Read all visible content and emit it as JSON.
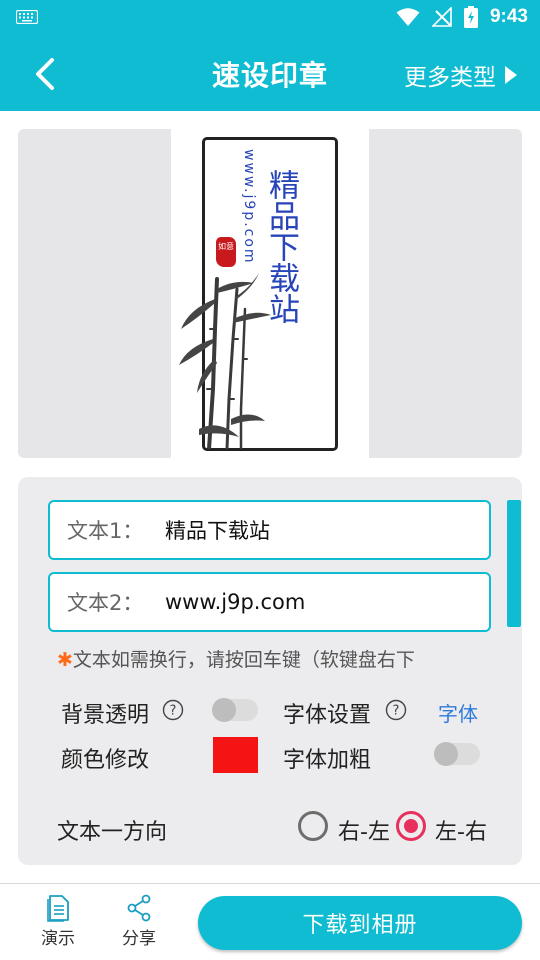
{
  "status_bar": {
    "time": "9:43",
    "icons": [
      "keyboard-icon",
      "wifi-icon",
      "no-signal-icon",
      "battery-charging-icon"
    ]
  },
  "header": {
    "title": "速设印章",
    "more_types": "更多类型",
    "back_icon": "chevron-left-icon",
    "more_icon": "triangle-right-icon"
  },
  "preview": {
    "stamp_text_1": "精品下载站",
    "stamp_text_2": "www.j9p.com",
    "seal_text": "如意",
    "colors": {
      "text": "#2745b9",
      "seal": "#c8191d",
      "frame": "#222222"
    }
  },
  "form": {
    "text1_label": "文本1：",
    "text1_value": "精品下载站",
    "text2_label": "文本2：",
    "text2_value": "www.j9p.com",
    "hint_star": "✱",
    "hint": "文本如需换行，请按回车键（软键盘右下",
    "bg_transparent_label": "背景透明",
    "bg_transparent_on": false,
    "font_settings_label": "字体设置",
    "font_link": "字体",
    "color_label": "颜色修改",
    "color_value": "#f41414",
    "bold_label": "字体加粗",
    "bold_on": false,
    "direction_label": "文本一方向",
    "direction_options": [
      {
        "label": "右-左",
        "checked": false
      },
      {
        "label": "左-右",
        "checked": true
      }
    ]
  },
  "bottom_bar": {
    "demo_label": "演示",
    "share_label": "分享",
    "download_label": "下载到相册"
  },
  "theme": {
    "accent": "#0fbcd2",
    "radio_active": "#e8305c",
    "link": "#2f7bdc"
  }
}
